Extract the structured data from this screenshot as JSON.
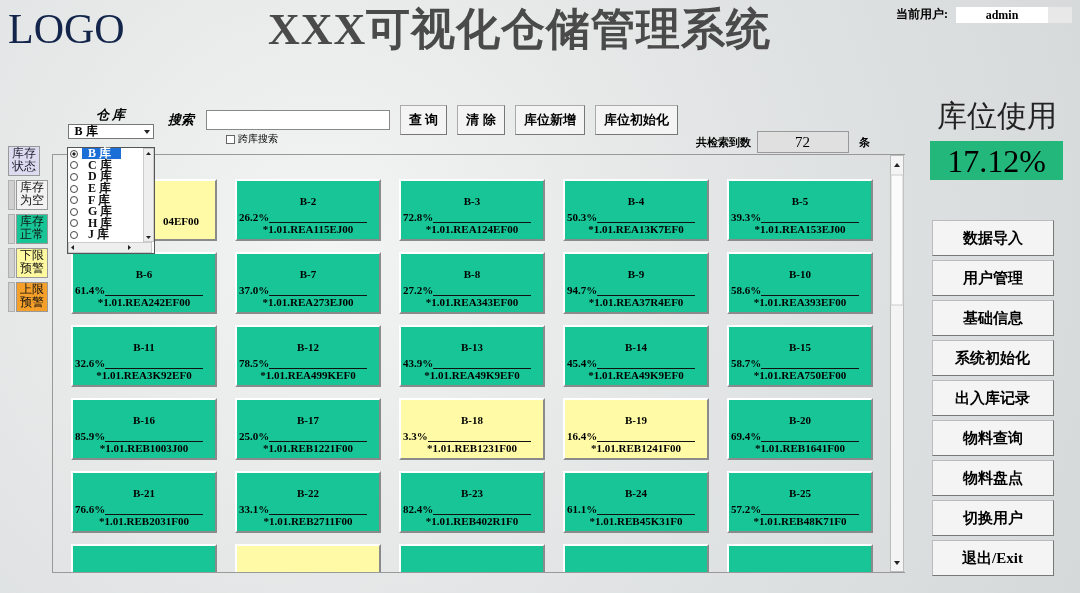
{
  "header": {
    "logo": "LOGO",
    "title": "XXX可视化仓储管理系统",
    "user_label": "当前用户:",
    "user_value": "admin"
  },
  "legend": [
    {
      "label": "库存状态",
      "kind": "header"
    },
    {
      "label": "库存为空",
      "kind": "empty"
    },
    {
      "label": "库存正常",
      "kind": "normal"
    },
    {
      "label": "下限预警",
      "kind": "low"
    },
    {
      "label": "上限预警",
      "kind": "high"
    }
  ],
  "toolbar": {
    "warehouse_label": "仓 库",
    "warehouse_value": "B 库",
    "search_label": "搜索",
    "cross_search": {
      "label": "跨库搜索",
      "checked": false
    },
    "buttons": [
      "查 询",
      "清 除",
      "库位新增",
      "库位初始化"
    ],
    "count_label": "共检索到数",
    "count_value": "72",
    "count_unit": "条"
  },
  "warehouse_options": [
    {
      "label": "B 库",
      "selected": true
    },
    {
      "label": "C 库",
      "selected": false
    },
    {
      "label": "D 库",
      "selected": false
    },
    {
      "label": "E 库",
      "selected": false
    },
    {
      "label": "F 库",
      "selected": false
    },
    {
      "label": "G 库",
      "selected": false
    },
    {
      "label": "H 库",
      "selected": false
    },
    {
      "label": "J 库",
      "selected": false
    }
  ],
  "tiles": [
    {
      "color": "#fffaa6",
      "code": "04EF00"
    },
    {
      "color": "#17c596",
      "name": "B-2",
      "percent": "26.2%",
      "code": "*1.01.REA115EJ00"
    },
    {
      "color": "#17c596",
      "name": "B-3",
      "percent": "72.8%",
      "code": "*1.01.REA124EF00"
    },
    {
      "color": "#17c596",
      "name": "B-4",
      "percent": "50.3%",
      "code": "*1.01.REA13K7EF0"
    },
    {
      "color": "#17c596",
      "name": "B-5",
      "percent": "39.3%",
      "code": "*1.01.REA153EJ00"
    },
    {
      "color": "#17c596",
      "name": "B-6",
      "percent": "61.4%",
      "code": "*1.01.REA242EF00"
    },
    {
      "color": "#17c596",
      "name": "B-7",
      "percent": "37.0%",
      "code": "*1.01.REA273EJ00"
    },
    {
      "color": "#17c596",
      "name": "B-8",
      "percent": "27.2%",
      "code": "*1.01.REA343EF00"
    },
    {
      "color": "#17c596",
      "name": "B-9",
      "percent": "94.7%",
      "code": "*1.01.REA37R4EF0"
    },
    {
      "color": "#17c596",
      "name": "B-10",
      "percent": "58.6%",
      "code": "*1.01.REA393EF00"
    },
    {
      "color": "#17c596",
      "name": "B-11",
      "percent": "32.6%",
      "code": "*1.01.REA3K92EF0"
    },
    {
      "color": "#17c596",
      "name": "B-12",
      "percent": "78.5%",
      "code": "*1.01.REA499KEF0"
    },
    {
      "color": "#17c596",
      "name": "B-13",
      "percent": "43.9%",
      "code": "*1.01.REA49K9EF0"
    },
    {
      "color": "#17c596",
      "name": "B-14",
      "percent": "45.4%",
      "code": "*1.01.REA49K9EF0"
    },
    {
      "color": "#17c596",
      "name": "B-15",
      "percent": "58.7%",
      "code": "*1.01.REA750EF00"
    },
    {
      "color": "#17c596",
      "name": "B-16",
      "percent": "85.9%",
      "code": "*1.01.REB1003J00"
    },
    {
      "color": "#17c596",
      "name": "B-17",
      "percent": "25.0%",
      "code": "*1.01.REB1221F00"
    },
    {
      "color": "#fffaa6",
      "name": "B-18",
      "percent": "3.3%",
      "code": "*1.01.REB1231F00"
    },
    {
      "color": "#fffaa6",
      "name": "B-19",
      "percent": "16.4%",
      "code": "*1.01.REB1241F00"
    },
    {
      "color": "#17c596",
      "name": "B-20",
      "percent": "69.4%",
      "code": "*1.01.REB1641F00"
    },
    {
      "color": "#17c596",
      "name": "B-21",
      "percent": "76.6%",
      "code": "*1.01.REB2031F00"
    },
    {
      "color": "#17c596",
      "name": "B-22",
      "percent": "33.1%",
      "code": "*1.01.REB2711F00"
    },
    {
      "color": "#17c596",
      "name": "B-23",
      "percent": "82.4%",
      "code": "*1.01.REB402R1F0"
    },
    {
      "color": "#17c596",
      "name": "B-24",
      "percent": "61.1%",
      "code": "*1.01.REB45K31F0"
    },
    {
      "color": "#17c596",
      "name": "B-25",
      "percent": "57.2%",
      "code": "*1.01.REB48K71F0"
    },
    {
      "color": "#17c596"
    },
    {
      "color": "#fffaa6"
    },
    {
      "color": "#17c596"
    },
    {
      "color": "#17c596"
    },
    {
      "color": "#17c596"
    }
  ],
  "usage": {
    "label": "库位使用",
    "value": "17.12%"
  },
  "menu": [
    "数据导入",
    "用户管理",
    "基础信息",
    "系统初始化",
    "出入库记录",
    "物料查询",
    "物料盘点",
    "切换用户",
    "退出/Exit"
  ]
}
